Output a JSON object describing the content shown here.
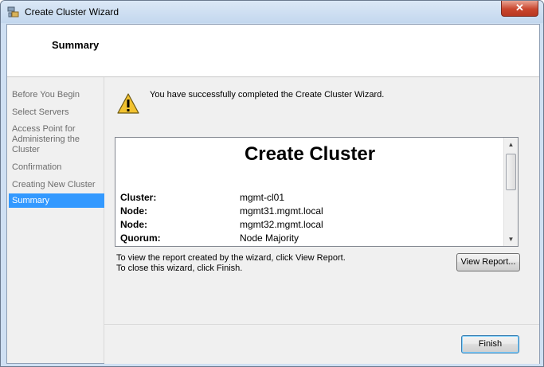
{
  "window": {
    "title": "Create Cluster Wizard",
    "close_label": "✕"
  },
  "header": {
    "title": "Summary"
  },
  "nav": {
    "items": [
      {
        "label": "Before You Begin"
      },
      {
        "label": "Select Servers"
      },
      {
        "label": "Access Point for Administering the Cluster"
      },
      {
        "label": "Confirmation"
      },
      {
        "label": "Creating New Cluster"
      },
      {
        "label": "Summary",
        "selected": true
      }
    ]
  },
  "content": {
    "message": "You have successfully completed the Create Cluster Wizard.",
    "report": {
      "title": "Create Cluster",
      "rows": [
        {
          "label": "Cluster:",
          "value": "mgmt-cl01"
        },
        {
          "label": "Node:",
          "value": "mgmt31.mgmt.local"
        },
        {
          "label": "Node:",
          "value": "mgmt32.mgmt.local"
        },
        {
          "label": "Quorum:",
          "value": "Node Majority"
        }
      ]
    },
    "instructions": {
      "line1": "To view the report created by the wizard, click View Report.",
      "line2": "To close this wizard, click Finish."
    },
    "view_report_label": "View Report...",
    "finish_label": "Finish"
  },
  "colors": {
    "selection": "#3399ff",
    "titlebar": "#c3d7ee",
    "close": "#c9462e"
  },
  "icons": [
    "cluster-app-icon",
    "warning-icon",
    "scroll-up-icon",
    "scroll-down-icon"
  ]
}
